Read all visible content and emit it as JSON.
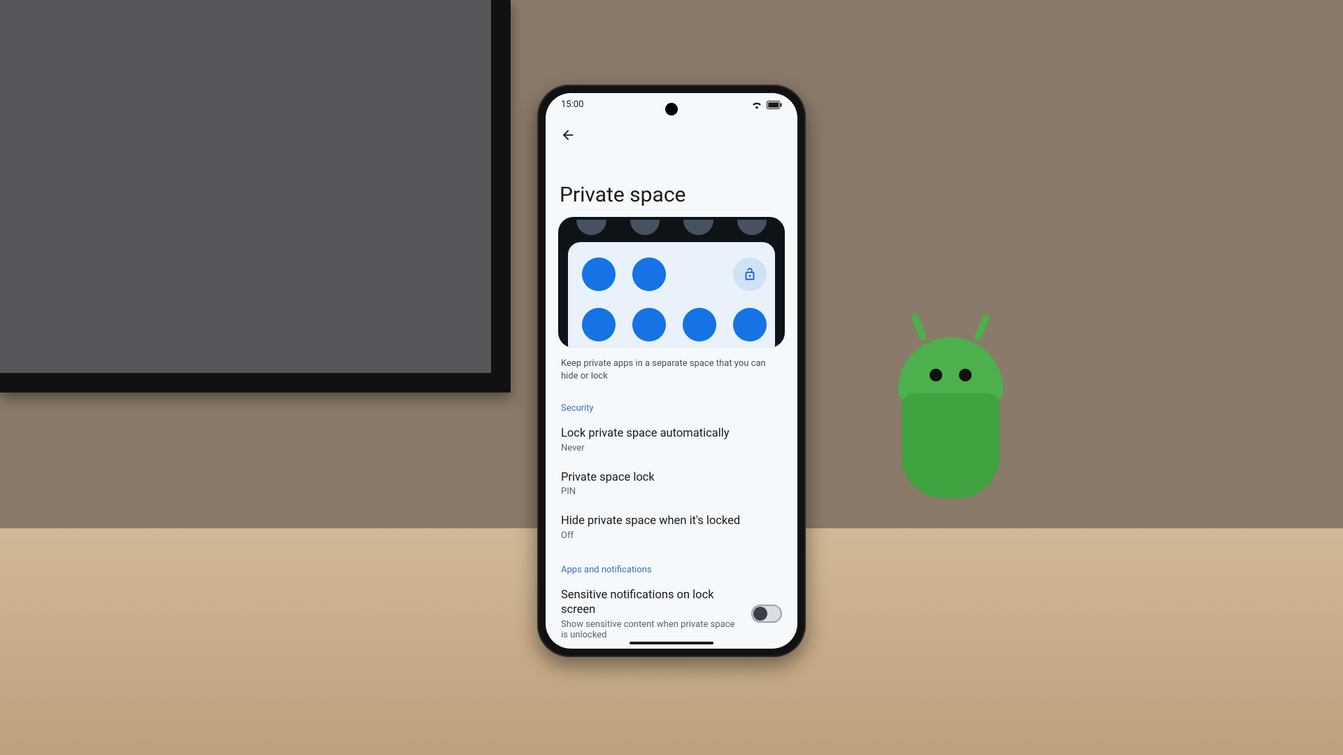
{
  "statusbar": {
    "time": "15:00"
  },
  "header": {
    "title": "Private space"
  },
  "description": "Keep private apps in a separate space that you can hide or lock",
  "sections": {
    "security": {
      "label": "Security",
      "items": [
        {
          "title": "Lock private space automatically",
          "sub": "Never"
        },
        {
          "title": "Private space lock",
          "sub": "PIN"
        },
        {
          "title": "Hide private space when it's locked",
          "sub": "Off"
        }
      ]
    },
    "apps": {
      "label": "Apps and notifications",
      "items": [
        {
          "title": "Sensitive notifications on lock screen",
          "sub": "Show sensitive content when private space is unlocked",
          "toggle": false
        }
      ]
    }
  }
}
